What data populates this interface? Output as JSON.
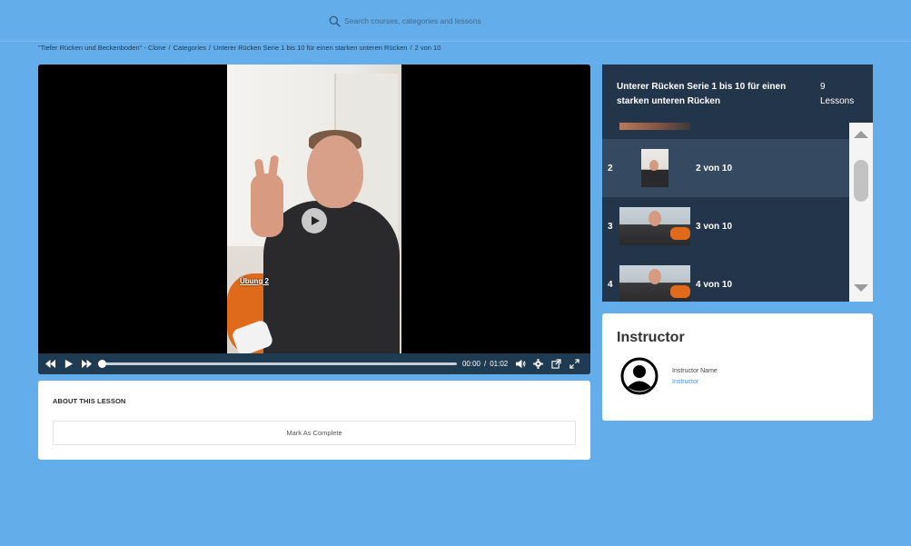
{
  "search": {
    "placeholder": "Search courses, categories and lessons"
  },
  "breadcrumb": {
    "items": [
      "\"Tiefer Rücken und Beckenboden\" - Clone",
      "Categories",
      "Unterer Rücken Serie 1 bis 10 für einen starken unteren Rücken",
      "2 von 10"
    ],
    "separator": "/"
  },
  "player": {
    "caption": "Übung 2",
    "current_time": "00:00",
    "duration": "01:02",
    "time_separator": "/",
    "progress": 0.0
  },
  "about": {
    "heading": "ABOUT THIS LESSON",
    "mark_complete_label": "Mark As Complete"
  },
  "playlist": {
    "title": "Unterer Rücken Serie 1 bis 10 für einen starken unteren Rücken",
    "lesson_count": "9",
    "lesson_count_label": "Lessons",
    "items": [
      {
        "number": "2",
        "label": "2 von 10",
        "active": true
      },
      {
        "number": "3",
        "label": "3 von 10",
        "active": false
      },
      {
        "number": "4",
        "label": "4 von 10",
        "active": false
      }
    ]
  },
  "instructor": {
    "heading": "Instructor",
    "name": "Instructor Name",
    "role": "Instructor"
  },
  "colors": {
    "background": "#63adea",
    "playlist_bg": "#23354a",
    "playlist_active": "#354a61",
    "controls_bg": "#1f3b52",
    "link": "#4a90d9"
  }
}
